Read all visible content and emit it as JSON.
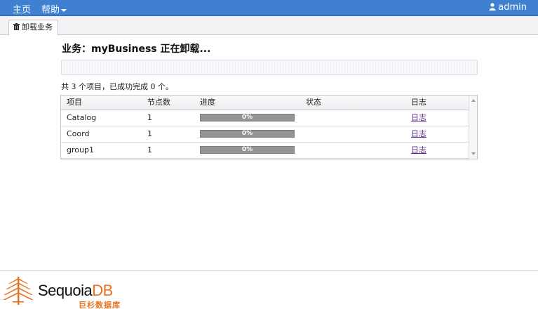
{
  "topbar": {
    "home": "主页",
    "help": "帮助",
    "user": "admin"
  },
  "tab": {
    "label": "卸载业务"
  },
  "task": {
    "title": "业务：myBusiness 正在卸载...",
    "progress": 0,
    "summary": "共 3 个项目，已成功完成 0 个。"
  },
  "table": {
    "headers": [
      "项目",
      "节点数",
      "进度",
      "状态",
      "日志"
    ],
    "rows": [
      {
        "item": "Catalog",
        "nodes": "1",
        "progress_label": "0%",
        "progress": 0,
        "status": "",
        "log": "日志"
      },
      {
        "item": "Coord",
        "nodes": "1",
        "progress_label": "0%",
        "progress": 0,
        "status": "",
        "log": "日志"
      },
      {
        "item": "group1",
        "nodes": "1",
        "progress_label": "0%",
        "progress": 0,
        "status": "",
        "log": "日志"
      }
    ]
  },
  "footer": {
    "logo_text_main": "Sequoia",
    "logo_text_accent": "DB",
    "logo_subtitle": "巨杉数据库"
  },
  "colors": {
    "topbar": "#3f80d0",
    "brand_orange": "#e8741f",
    "progress_gray": "#949494"
  }
}
